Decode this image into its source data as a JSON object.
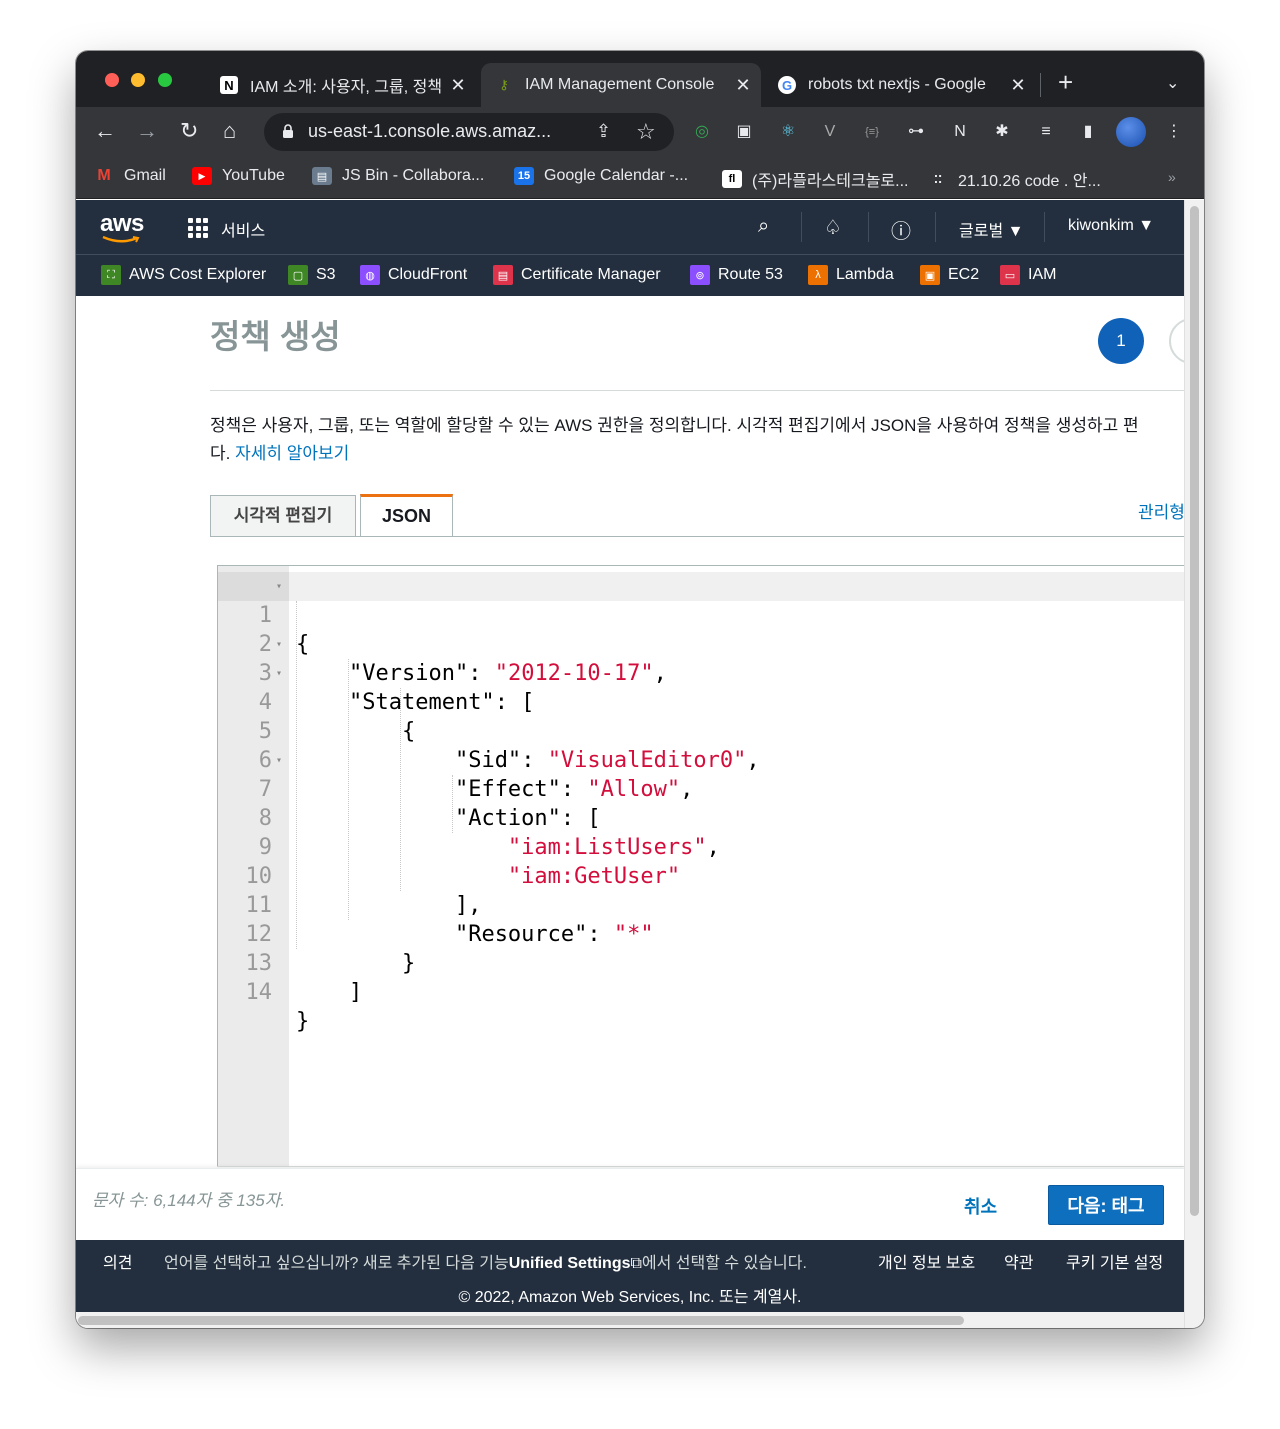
{
  "browser": {
    "tabs": [
      {
        "label": "IAM 소개: 사용자, 그룹, 정책",
        "icon": "notion-icon"
      },
      {
        "label": "IAM Management Console",
        "icon": "aws-iam-icon"
      },
      {
        "label": "robots txt nextjs - Google",
        "icon": "google-icon"
      }
    ],
    "url": "us-east-1.console.aws.amaz...",
    "bookmarks": [
      {
        "label": "Gmail",
        "color": "#ea4335"
      },
      {
        "label": "YouTube",
        "color": "#ff0000"
      },
      {
        "label": "JS Bin - Collabora...",
        "color": "#6a7c8e"
      },
      {
        "label": "Google Calendar -...",
        "color": "#1a73e8"
      },
      {
        "label": "(주)라플라스테크놀로...",
        "color": "#ffffff"
      },
      {
        "label": "21.10.26 code . 안...",
        "color": "#e8eaed"
      }
    ],
    "more": "»"
  },
  "aws": {
    "logo": "aws",
    "services_label": "서비스",
    "region": "글로벌 ▼",
    "user": "kiwonkim ▼",
    "favorites": [
      {
        "label": "AWS Cost Explorer",
        "color": "#3f8624"
      },
      {
        "label": "S3",
        "color": "#3f8624"
      },
      {
        "label": "CloudFront",
        "color": "#8c4fff"
      },
      {
        "label": "Certificate Manager",
        "color": "#dd344c"
      },
      {
        "label": "Route 53",
        "color": "#8c4fff"
      },
      {
        "label": "Lambda",
        "color": "#ed7100"
      },
      {
        "label": "EC2",
        "color": "#ed7100"
      },
      {
        "label": "IAM",
        "color": "#dd344c"
      }
    ]
  },
  "page": {
    "title": "정책 생성",
    "step": "1",
    "description_line1": "정책은 사용자, 그룹, 또는 역할에 할당할 수 있는 AWS 권한을 정의합니다. 시각적 편집기에서 JSON을 사용하여 정책을 생성하고 편",
    "description_line2_prefix": "다. ",
    "learn_more": "자세히 알아보기",
    "tab_visual": "시각적 편집기",
    "tab_json": "JSON",
    "manage_link": "관리형"
  },
  "editor": {
    "lines": [
      {
        "num": "1",
        "fold": true
      },
      {
        "num": "2",
        "fold": false
      },
      {
        "num": "3",
        "fold": true
      },
      {
        "num": "4",
        "fold": true
      },
      {
        "num": "5",
        "fold": false
      },
      {
        "num": "6",
        "fold": false
      },
      {
        "num": "7",
        "fold": true
      },
      {
        "num": "8",
        "fold": false
      },
      {
        "num": "9",
        "fold": false
      },
      {
        "num": "10",
        "fold": false
      },
      {
        "num": "11",
        "fold": false
      },
      {
        "num": "12",
        "fold": false
      },
      {
        "num": "13",
        "fold": false
      },
      {
        "num": "14",
        "fold": false
      }
    ],
    "tokens": {
      "open_brace": "{",
      "version_key": "\"Version\"",
      "version_val": "\"2012-10-17\"",
      "statement_key": "\"Statement\"",
      "sid_key": "\"Sid\"",
      "sid_val": "\"VisualEditor0\"",
      "effect_key": "\"Effect\"",
      "effect_val": "\"Allow\"",
      "action_key": "\"Action\"",
      "action_1": "\"iam:ListUsers\"",
      "action_2": "\"iam:GetUser\"",
      "resource_key": "\"Resource\"",
      "resource_val": "\"*\""
    }
  },
  "actions": {
    "char_count": "문자 수: 6,144자 중 135자.",
    "cancel": "취소",
    "next": "다음: 태그"
  },
  "footer": {
    "feedback": "의견",
    "lang_prefix": "언어를 선택하고 싶으십니까? 새로 추가된 다음 기능",
    "lang_link": "Unified Settings",
    "lang_suffix": "에서 선택할 수 있습니다.",
    "privacy": "개인 정보 보호",
    "terms": "약관",
    "cookies": "쿠키 기본 설정",
    "copyright": "© 2022, Amazon Web Services, Inc. 또는 계열사."
  }
}
